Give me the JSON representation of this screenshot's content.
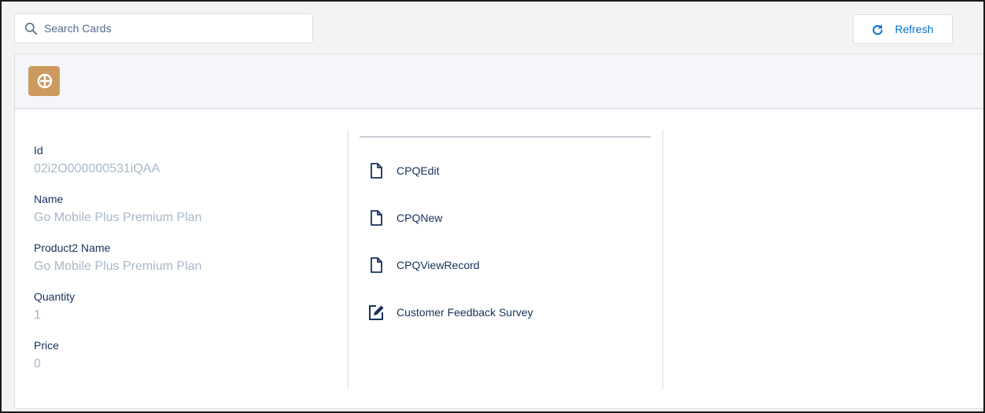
{
  "search": {
    "placeholder": "Search Cards",
    "icon": "search-icon"
  },
  "toolbar": {
    "refresh_label": "Refresh",
    "refresh_icon": "refresh-icon"
  },
  "card": {
    "icon": "product-consumed-icon",
    "icon_color": "#cc9a5f",
    "fields": [
      {
        "label": "Id",
        "value": "02i2O000000531iQAA"
      },
      {
        "label": "Name",
        "value": "Go Mobile Plus Premium Plan"
      },
      {
        "label": "Product2 Name",
        "value": "Go Mobile Plus Premium Plan"
      },
      {
        "label": "Quantity",
        "value": "1"
      },
      {
        "label": "Price",
        "value": "0"
      }
    ],
    "actions": [
      {
        "label": "CPQEdit",
        "icon": "document-icon"
      },
      {
        "label": "CPQNew",
        "icon": "document-icon"
      },
      {
        "label": "CPQViewRecord",
        "icon": "document-icon"
      },
      {
        "label": "Customer Feedback Survey",
        "icon": "edit-form-icon"
      }
    ]
  },
  "colors": {
    "accent": "#0070d2",
    "label": "#16325c",
    "value": "#a8b7c7"
  }
}
